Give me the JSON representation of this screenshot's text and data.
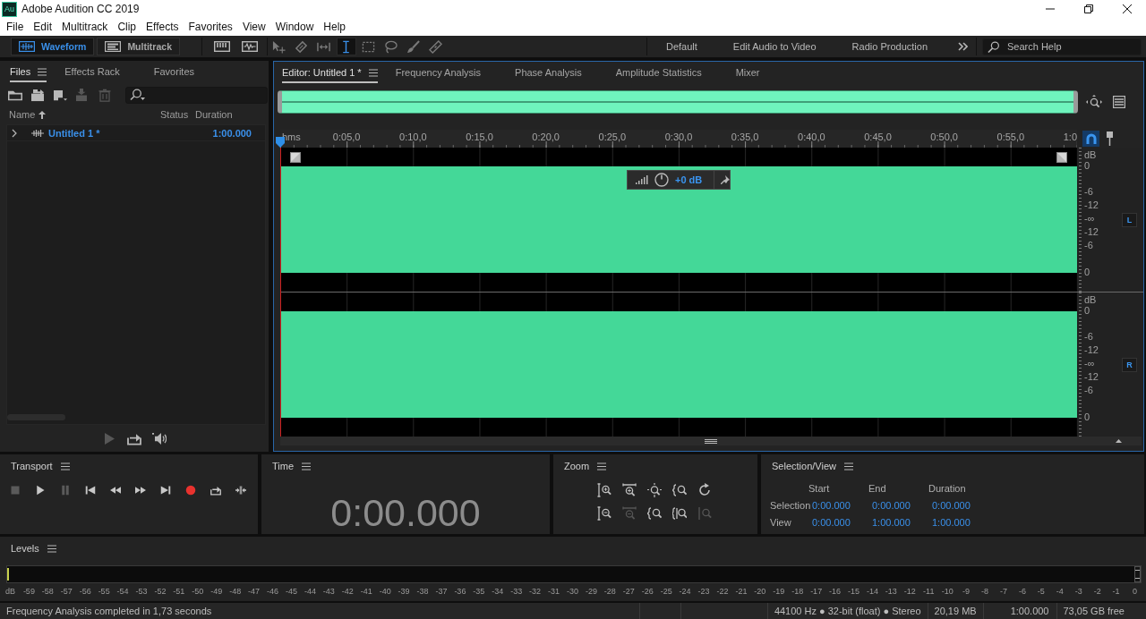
{
  "window": {
    "logo": "Au",
    "title": "Adobe Audition CC 2019"
  },
  "menu": [
    "File",
    "Edit",
    "Multitrack",
    "Clip",
    "Effects",
    "Favorites",
    "View",
    "Window",
    "Help"
  ],
  "toolbar": {
    "views": [
      {
        "kind": "waveform",
        "label": "Waveform",
        "selected": true
      },
      {
        "kind": "multitrack",
        "label": "Multitrack",
        "selected": false
      }
    ],
    "tools": [
      {
        "kind": "move",
        "selected": false
      },
      {
        "kind": "razor",
        "selected": false
      },
      {
        "kind": "slip",
        "selected": false
      },
      {
        "kind": "select",
        "selected": true
      },
      {
        "kind": "marquee",
        "selected": false
      },
      {
        "kind": "lasso",
        "selected": false
      },
      {
        "kind": "brush",
        "selected": false
      },
      {
        "kind": "heal",
        "selected": false
      }
    ],
    "workspaces": [
      "Default",
      "Edit Audio to Video",
      "Radio Production"
    ],
    "search": {
      "placeholder": "Search Help"
    }
  },
  "files_panel": {
    "tabs": [
      {
        "label": "Files",
        "selected": true
      },
      {
        "label": "Effects Rack",
        "selected": false
      },
      {
        "label": "Favorites",
        "selected": false
      }
    ],
    "actions": [
      {
        "kind": "open",
        "disabled": false
      },
      {
        "kind": "import",
        "disabled": false
      },
      {
        "kind": "new",
        "disabled": false
      },
      {
        "kind": "insert",
        "disabled": true
      },
      {
        "kind": "delete",
        "disabled": true
      }
    ],
    "columns": [
      {
        "label": "Name",
        "sorted": true
      },
      {
        "label": "Status",
        "sorted": false
      },
      {
        "label": "Duration",
        "sorted": false
      }
    ],
    "rows": [
      {
        "name": "Untitled 1 *",
        "duration": "1:00.000",
        "expanded": false,
        "open": true
      }
    ],
    "preview": [
      {
        "kind": "play",
        "disabled": true
      },
      {
        "kind": "loop",
        "disabled": false
      },
      {
        "kind": "autoplay",
        "disabled": false
      }
    ]
  },
  "editor": {
    "tabs": [
      {
        "label": "Editor: Untitled 1 *",
        "selected": true
      },
      {
        "label": "Frequency Analysis",
        "selected": false
      },
      {
        "label": "Phase Analysis",
        "selected": false
      },
      {
        "label": "Amplitude Statistics",
        "selected": false
      },
      {
        "label": "Mixer",
        "selected": false
      }
    ],
    "snapping": true,
    "ruler": {
      "unit": "hms",
      "labels": [
        "0:05,0",
        "0:10,0",
        "0:15,0",
        "0:20,0",
        "0:25,0",
        "0:30,0",
        "0:35,0",
        "0:40,0",
        "0:45,0",
        "0:50,0",
        "0:55,0",
        "1:0"
      ]
    },
    "hud": {
      "reading": "+0 dB"
    },
    "channels": [
      {
        "label": "L",
        "on": true,
        "scale": [
          "dB",
          "0",
          "-6",
          "-12",
          "-∞",
          "-12",
          "-6",
          "0"
        ]
      },
      {
        "label": "R",
        "on": true,
        "scale": [
          "dB",
          "0",
          "-6",
          "-12",
          "-∞",
          "-12",
          "-6",
          "0"
        ]
      }
    ]
  },
  "transport": {
    "title": "Transport",
    "buttons": [
      {
        "kind": "stop",
        "disabled": true
      },
      {
        "kind": "play",
        "disabled": false
      },
      {
        "kind": "pause",
        "disabled": true
      },
      {
        "kind": "start",
        "disabled": false
      },
      {
        "kind": "rewind",
        "disabled": false
      },
      {
        "kind": "forward",
        "disabled": false
      },
      {
        "kind": "end",
        "disabled": false
      },
      {
        "kind": "record",
        "disabled": false
      },
      {
        "kind": "loop",
        "disabled": false
      },
      {
        "kind": "skip",
        "disabled": false
      }
    ]
  },
  "time": {
    "title": "Time",
    "value": "0:00.000"
  },
  "zoom": {
    "title": "Zoom",
    "buttons": [
      {
        "kind": "ampin",
        "disabled": false
      },
      {
        "kind": "timein",
        "disabled": false
      },
      {
        "kind": "full",
        "disabled": false
      },
      {
        "kind": "inpoint",
        "disabled": false
      },
      {
        "kind": "history",
        "disabled": false
      },
      {
        "kind": "ampout",
        "disabled": false
      },
      {
        "kind": "timeout",
        "disabled": true
      },
      {
        "kind": "outpoint",
        "disabled": false
      },
      {
        "kind": "selection",
        "disabled": false
      },
      {
        "kind": "reset",
        "disabled": true
      }
    ]
  },
  "selection_view": {
    "title": "Selection/View",
    "columns": [
      "Start",
      "End",
      "Duration"
    ],
    "rows": [
      {
        "label": "Selection",
        "start": "0:00.000",
        "end": "0:00.000",
        "duration": "0:00.000"
      },
      {
        "label": "View",
        "start": "0:00.000",
        "end": "1:00.000",
        "duration": "1:00.000"
      }
    ]
  },
  "levels": {
    "title": "Levels",
    "scale": [
      "dB",
      "-59",
      "-58",
      "-57",
      "-56",
      "-55",
      "-54",
      "-53",
      "-52",
      "-51",
      "-50",
      "-49",
      "-48",
      "-47",
      "-46",
      "-45",
      "-44",
      "-43",
      "-42",
      "-41",
      "-40",
      "-39",
      "-38",
      "-37",
      "-36",
      "-35",
      "-34",
      "-33",
      "-32",
      "-31",
      "-30",
      "-29",
      "-28",
      "-27",
      "-26",
      "-25",
      "-24",
      "-23",
      "-22",
      "-21",
      "-20",
      "-19",
      "-18",
      "-17",
      "-16",
      "-15",
      "-14",
      "-13",
      "-12",
      "-11",
      "-10",
      "-9",
      "-8",
      "-7",
      "-6",
      "-5",
      "-4",
      "-3",
      "-2",
      "-1",
      "0"
    ]
  },
  "status_bar": {
    "message": "Frequency Analysis completed in 1,73 seconds",
    "format": "44100 Hz ● 32-bit (float) ● Stereo",
    "size": "20,19 MB",
    "duration": "1:00.000",
    "free_space": "73,05 GB free"
  }
}
